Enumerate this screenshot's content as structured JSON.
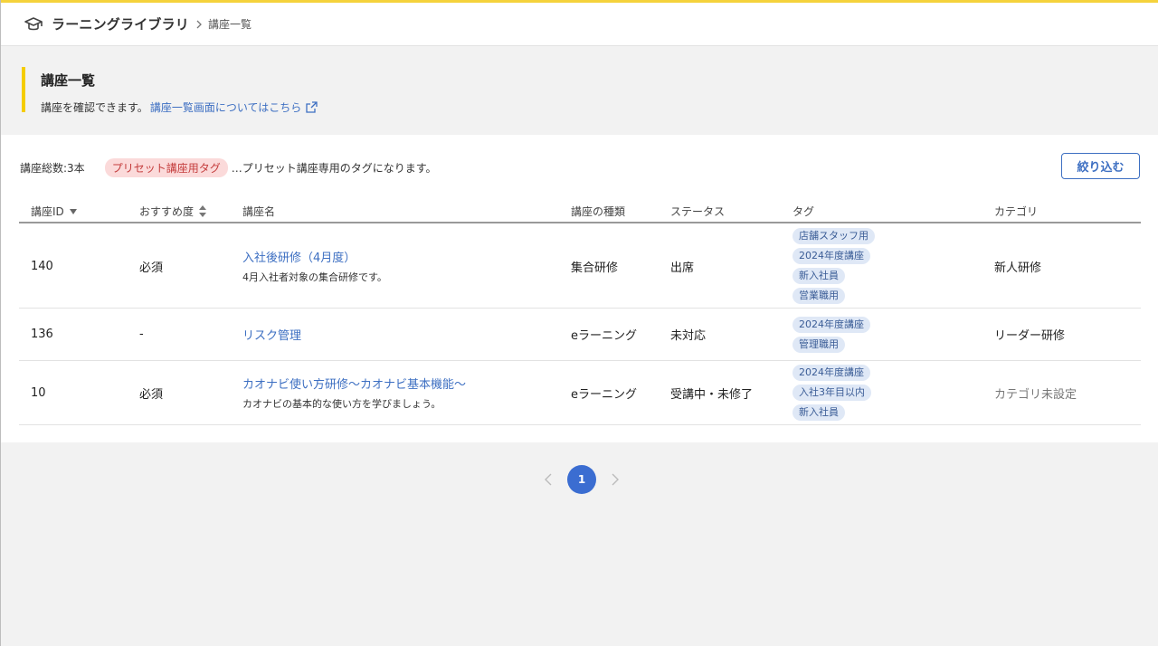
{
  "header": {
    "app_title": "ラーニングライブラリ",
    "breadcrumb_current": "講座一覧",
    "icon": "graduation-cap-icon"
  },
  "page": {
    "title": "講座一覧",
    "description": "講座を確認できます。",
    "help_link": "講座一覧画面についてはこちら"
  },
  "summary": {
    "total": "講座総数:3本",
    "preset_tag": "プリセット講座用タグ",
    "preset_note": "…プリセット講座専用のタグになります。"
  },
  "filter_button": "絞り込む",
  "table": {
    "headers": {
      "id": "講座ID",
      "recommend": "おすすめ度",
      "name": "講座名",
      "type": "講座の種類",
      "status": "ステータス",
      "tags": "タグ",
      "category": "カテゴリ"
    },
    "rows": [
      {
        "id": "140",
        "recommend": "必須",
        "name": "入社後研修（4月度）",
        "desc": "4月入社者対象の集合研修です。",
        "type": "集合研修",
        "status": "出席",
        "tags": [
          "店舗スタッフ用",
          "2024年度講座",
          "新入社員",
          "営業職用"
        ],
        "category": "新人研修"
      },
      {
        "id": "136",
        "recommend": "-",
        "name": "リスク管理",
        "desc": "",
        "type": "eラーニング",
        "status": "未対応",
        "tags": [
          "2024年度講座",
          "管理職用"
        ],
        "category": "リーダー研修"
      },
      {
        "id": "10",
        "recommend": "必須",
        "name": "カオナビ使い方研修～カオナビ基本機能～",
        "desc": "カオナビの基本的な使い方を学びましょう。",
        "type": "eラーニング",
        "status": "受講中・未修了",
        "tags": [
          "2024年度講座",
          "入社3年目以内",
          "新入社員"
        ],
        "category": "カテゴリ未設定"
      }
    ]
  },
  "pagination": {
    "current": "1"
  },
  "colors": {
    "accent": "#3d6fc2",
    "brand_yellow": "#f5cd00",
    "preset_tag_bg": "#fbdada",
    "tag_bg": "#dfe8f6"
  }
}
